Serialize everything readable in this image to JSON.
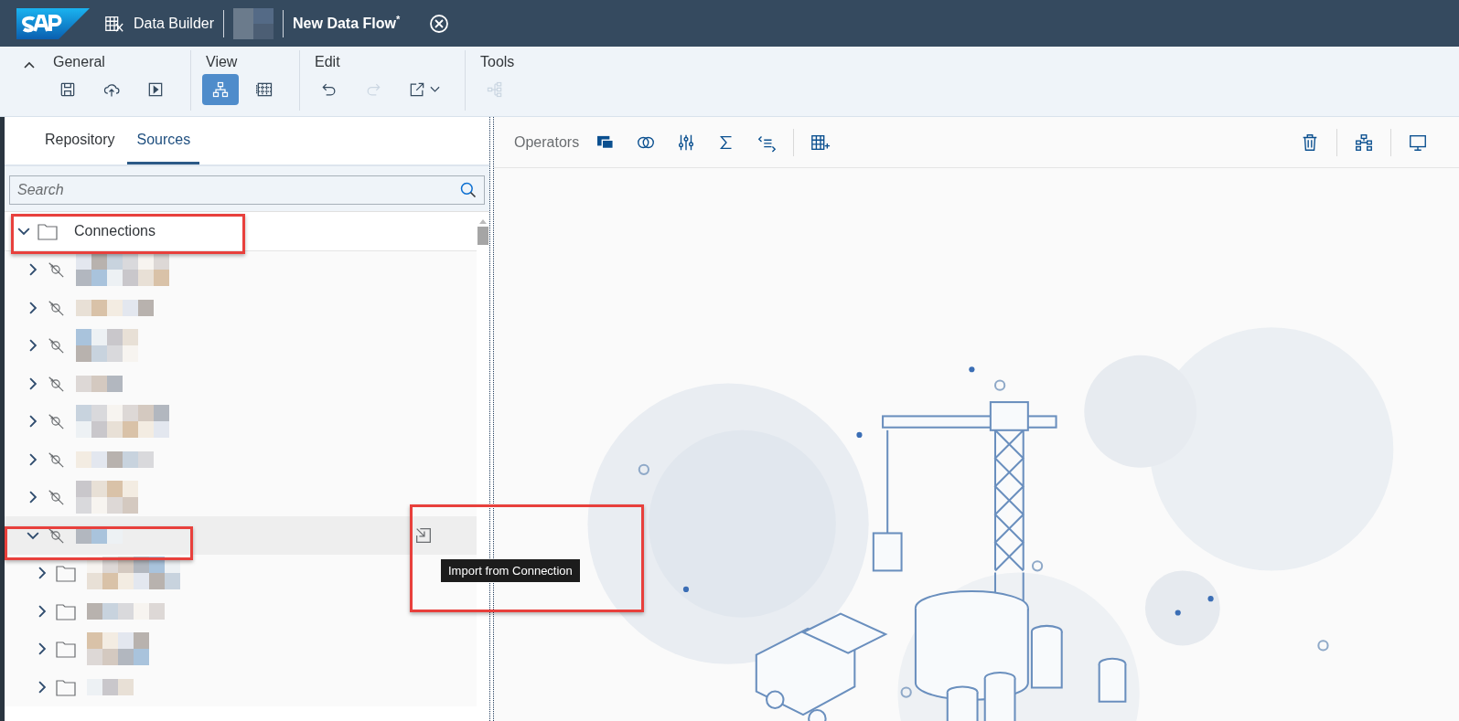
{
  "header": {
    "app": "Data Builder",
    "title": "New Data Flow",
    "modified_mark": "*"
  },
  "toolbar": {
    "collapsed": false,
    "groups": [
      {
        "label": "General",
        "buttons": [
          {
            "kind": "save",
            "selected": false,
            "disabled": false
          },
          {
            "kind": "deploy",
            "selected": false,
            "disabled": false
          },
          {
            "kind": "run",
            "selected": false,
            "disabled": false
          }
        ]
      },
      {
        "label": "View",
        "buttons": [
          {
            "kind": "diagram",
            "selected": true,
            "disabled": false
          },
          {
            "kind": "table",
            "selected": false,
            "disabled": false
          }
        ]
      },
      {
        "label": "Edit",
        "buttons": [
          {
            "kind": "undo",
            "selected": false,
            "disabled": false
          },
          {
            "kind": "redo",
            "selected": false,
            "disabled": true
          },
          {
            "kind": "export",
            "selected": false,
            "disabled": false
          }
        ]
      },
      {
        "label": "Tools",
        "buttons": [
          {
            "kind": "impact",
            "selected": false,
            "disabled": true
          }
        ]
      }
    ]
  },
  "tabs": [
    {
      "label": "Repository",
      "selected": false
    },
    {
      "label": "Sources",
      "selected": true
    }
  ],
  "search": {
    "placeholder": "Search"
  },
  "tree": [
    {
      "kind": "folder",
      "label": "Connections",
      "expanded": true,
      "selected": false,
      "children": [
        {
          "kind": "connection",
          "expanded": false,
          "selected": false
        },
        {
          "kind": "connection",
          "expanded": false,
          "selected": false
        },
        {
          "kind": "connection",
          "expanded": false,
          "selected": false
        },
        {
          "kind": "connection",
          "expanded": false,
          "selected": false
        },
        {
          "kind": "connection",
          "expanded": false,
          "selected": false
        },
        {
          "kind": "connection",
          "expanded": false,
          "selected": false
        },
        {
          "kind": "connection",
          "expanded": false,
          "selected": false
        },
        {
          "kind": "connection",
          "expanded": true,
          "selected": true,
          "children": [
            {
              "kind": "folder",
              "expanded": false,
              "selected": false
            },
            {
              "kind": "folder",
              "expanded": false,
              "selected": false
            },
            {
              "kind": "folder",
              "expanded": false,
              "selected": false
            },
            {
              "kind": "folder",
              "expanded": false,
              "selected": false
            }
          ]
        }
      ]
    }
  ],
  "tooltip": "Import from Connection",
  "canvas_toolbar": {
    "label": "Operators"
  }
}
